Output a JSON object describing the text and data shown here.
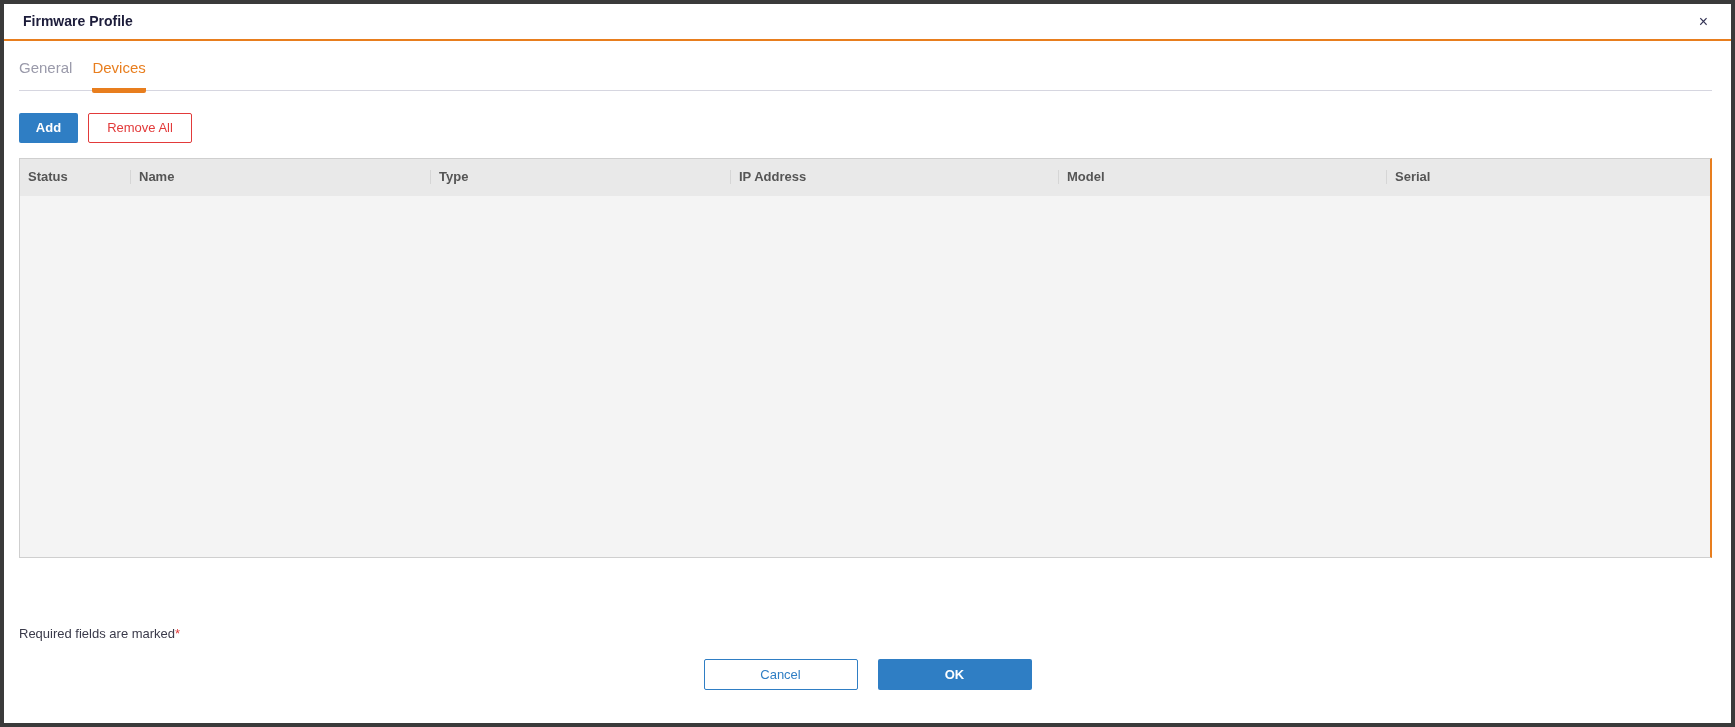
{
  "window": {
    "title": "Firmware Profile",
    "close": "×"
  },
  "tabs": [
    {
      "label": "General",
      "selected": false
    },
    {
      "label": "Devices",
      "selected": true
    }
  ],
  "toolbar": {
    "add": "Add",
    "remove_all": "Remove All"
  },
  "table": {
    "columns": [
      "Status",
      "Name",
      "Type",
      "IP Address",
      "Model",
      "Serial"
    ]
  },
  "note": {
    "text": "Required fields are marked",
    "mark": "*"
  },
  "buttons": {
    "cancel": "Cancel",
    "ok": "OK"
  }
}
